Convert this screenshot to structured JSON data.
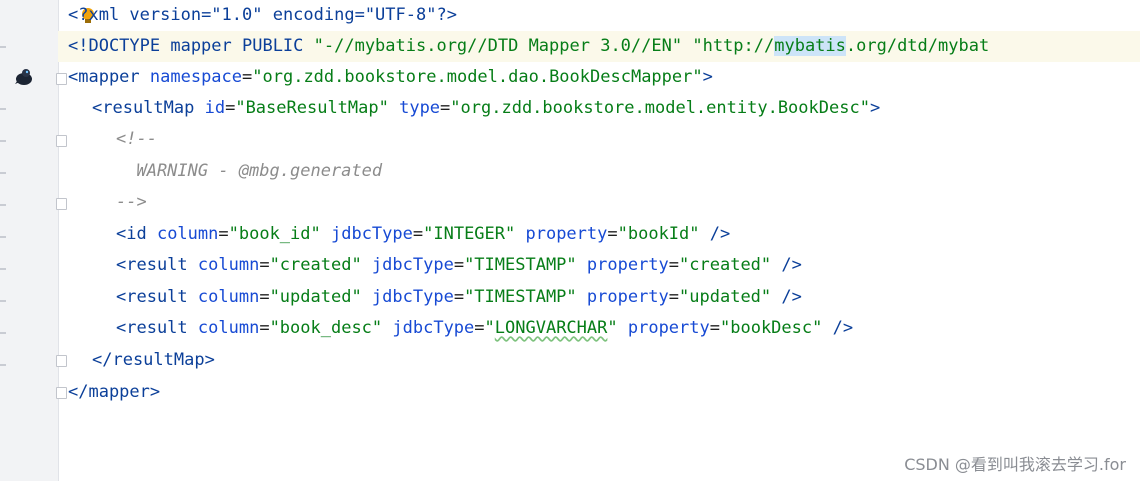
{
  "editor": {
    "lines": [
      {
        "t1": "<",
        "t2": "?xml version=\"1.0\" encoding=\"UTF-8\"?>"
      },
      {
        "t1": "<!DOCTYPE mapper PUBLIC ",
        "t2": "\"-//mybatis.org//DTD Mapper 3.0//EN\"",
        "t3": " \"http://",
        "t4": "mybatis",
        "t5": ".org/dtd/mybat"
      },
      {
        "open": "<mapper ",
        "a1": "namespace",
        "eq": "=",
        "v1": "\"org.zdd.bookstore.model.dao.BookDescMapper\"",
        "close": ">"
      },
      {
        "open": "<resultMap ",
        "a1": "id",
        "eq1": "=",
        "v1": "\"BaseResultMap\"",
        "a2": " type",
        "eq2": "=",
        "v2": "\"org.zdd.bookstore.model.entity.BookDesc\"",
        "close": ">"
      },
      {
        "text": "<!--"
      },
      {
        "text": "  WARNING - @mbg.generated"
      },
      {
        "text": "-->"
      },
      {
        "open": "<id ",
        "a1": "column",
        "v1": "\"book_id\"",
        "a2": " jdbcType",
        "v2": "\"INTEGER\"",
        "a3": " property",
        "v3": "\"bookId\"",
        "close": " />"
      },
      {
        "open": "<result ",
        "a1": "column",
        "v1": "\"created\"",
        "a2": " jdbcType",
        "v2": "\"TIMESTAMP\"",
        "a3": " property",
        "v3": "\"created\"",
        "close": " />"
      },
      {
        "open": "<result ",
        "a1": "column",
        "v1": "\"updated\"",
        "a2": " jdbcType",
        "v2": "\"TIMESTAMP\"",
        "a3": " property",
        "v3": "\"updated\"",
        "close": " />"
      },
      {
        "open": "<result ",
        "a1": "column",
        "v1": "\"book_desc\"",
        "a2": " jdbcType",
        "v2a": "\"",
        "v2b": "LONGVARCHAR",
        "v2c": "\"",
        "a3": " property",
        "v3": "\"bookDesc\"",
        "close": " />"
      },
      {
        "text": "</resultMap>"
      },
      {
        "text": "</mapper>"
      }
    ]
  },
  "watermark": "CSDN @看到叫我滚去学习.for"
}
